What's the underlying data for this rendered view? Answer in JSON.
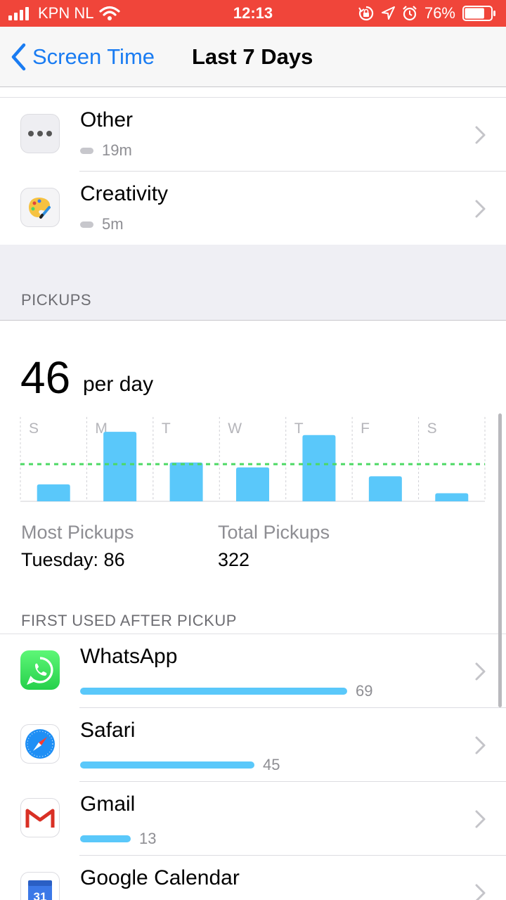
{
  "status_bar": {
    "carrier": "KPN NL",
    "time": "12:13",
    "battery": "76%",
    "battery_level": 0.76,
    "background_color": "#f0453a"
  },
  "nav": {
    "back_label": "Screen Time",
    "title": "Last 7 Days",
    "accent_color": "#1a7cf2"
  },
  "categories": [
    {
      "name": "Other",
      "time": "19m",
      "icon": "ellipsis-icon"
    },
    {
      "name": "Creativity",
      "time": "5m",
      "icon": "palette-icon"
    }
  ],
  "pickups": {
    "section_label": "PICKUPS",
    "average": "46",
    "average_unit": "per day",
    "most_label": "Most Pickups",
    "most_value": "Tuesday: 86",
    "total_label": "Total Pickups",
    "total_value": "322"
  },
  "chart_data": {
    "type": "bar",
    "categories": [
      "S",
      "M",
      "T",
      "W",
      "T",
      "F",
      "S"
    ],
    "values": [
      21,
      86,
      48,
      42,
      82,
      31,
      10
    ],
    "average": 46,
    "ylim": [
      0,
      100
    ],
    "bar_color": "#5ac8fa",
    "average_line_color": "#4cd964"
  },
  "first_used": {
    "section_label": "FIRST USED AFTER PICKUP",
    "max": 69,
    "apps": [
      {
        "name": "WhatsApp",
        "count": "69",
        "value": 69,
        "icon": "whatsapp-icon"
      },
      {
        "name": "Safari",
        "count": "45",
        "value": 45,
        "icon": "safari-icon"
      },
      {
        "name": "Gmail",
        "count": "13",
        "value": 13,
        "icon": "gmail-icon"
      },
      {
        "name": "Google Calendar",
        "count": "",
        "value": 0,
        "icon": "google-calendar-icon",
        "calendar_day": "31"
      }
    ]
  }
}
